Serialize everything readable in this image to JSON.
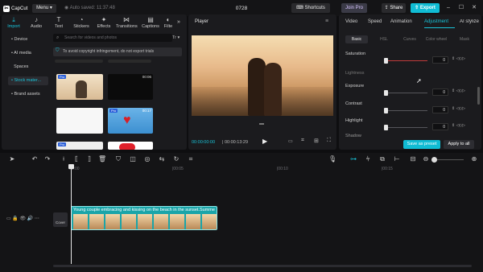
{
  "titlebar": {
    "app_name": "CapCut",
    "menu_label": "Menu",
    "autosave": "Auto saved: 11:37:48",
    "project_title": "0728",
    "shortcuts_label": "Shortcuts",
    "joinpro_label": "Join Pro",
    "share_label": "Share",
    "export_label": "Export"
  },
  "media_panel": {
    "tabs": [
      {
        "label": "Import",
        "icon": "import-icon"
      },
      {
        "label": "Audio",
        "icon": "audio-icon"
      },
      {
        "label": "Text",
        "icon": "text-icon"
      },
      {
        "label": "Stickers",
        "icon": "stickers-icon"
      },
      {
        "label": "Effects",
        "icon": "effects-icon"
      },
      {
        "label": "Transitions",
        "icon": "transitions-icon"
      },
      {
        "label": "Captions",
        "icon": "captions-icon"
      },
      {
        "label": "Filte",
        "icon": "filters-icon"
      }
    ],
    "sidebar": [
      "Device",
      "AI media",
      "Spaces",
      "Stock mater...",
      "Brand assets"
    ],
    "search_placeholder": "Search for videos and photos",
    "notice": "To avoid copyright infringement, do not export trials",
    "thumbs": [
      {
        "badge": "Pro",
        "duration": ""
      },
      {
        "badge": "",
        "duration": "00:06"
      },
      {
        "badge": "",
        "duration": ""
      },
      {
        "badge": "Pro",
        "duration": "00:17"
      },
      {
        "badge": "Pro",
        "duration": ""
      },
      {
        "badge": "",
        "duration": ""
      }
    ]
  },
  "player": {
    "title": "Player",
    "current_time": "00:00:00:00",
    "total_time": "00:00:13:29"
  },
  "adjust_panel": {
    "tabs": [
      "Video",
      "Speed",
      "Animation",
      "Adjustment",
      "AI stylize"
    ],
    "active_tab": "Adjustment",
    "subtabs": [
      "Basic",
      "HSL",
      "Curves",
      "Color wheel",
      "Mask"
    ],
    "saturation_label": "Saturation",
    "lightness_label": "Lightness",
    "params": [
      {
        "label": "Saturation",
        "value": "0"
      },
      {
        "label": "Exposure",
        "value": "0"
      },
      {
        "label": "Contrast",
        "value": "0"
      },
      {
        "label": "Highlight",
        "value": "0"
      },
      {
        "label": "Shadow",
        "value": "0"
      }
    ],
    "save_preset": "Save as preset",
    "apply_all": "Apply to all"
  },
  "timeline": {
    "ruler": [
      "00:00",
      "|00:05",
      "|00:10",
      "|00:15"
    ],
    "clip_title": "Young couple embracing and kissing on the beach in the sunset.Summe",
    "cover_label": "Cover"
  },
  "colors": {
    "accent": "#10bcd4",
    "clip": "#1aa5a9"
  }
}
